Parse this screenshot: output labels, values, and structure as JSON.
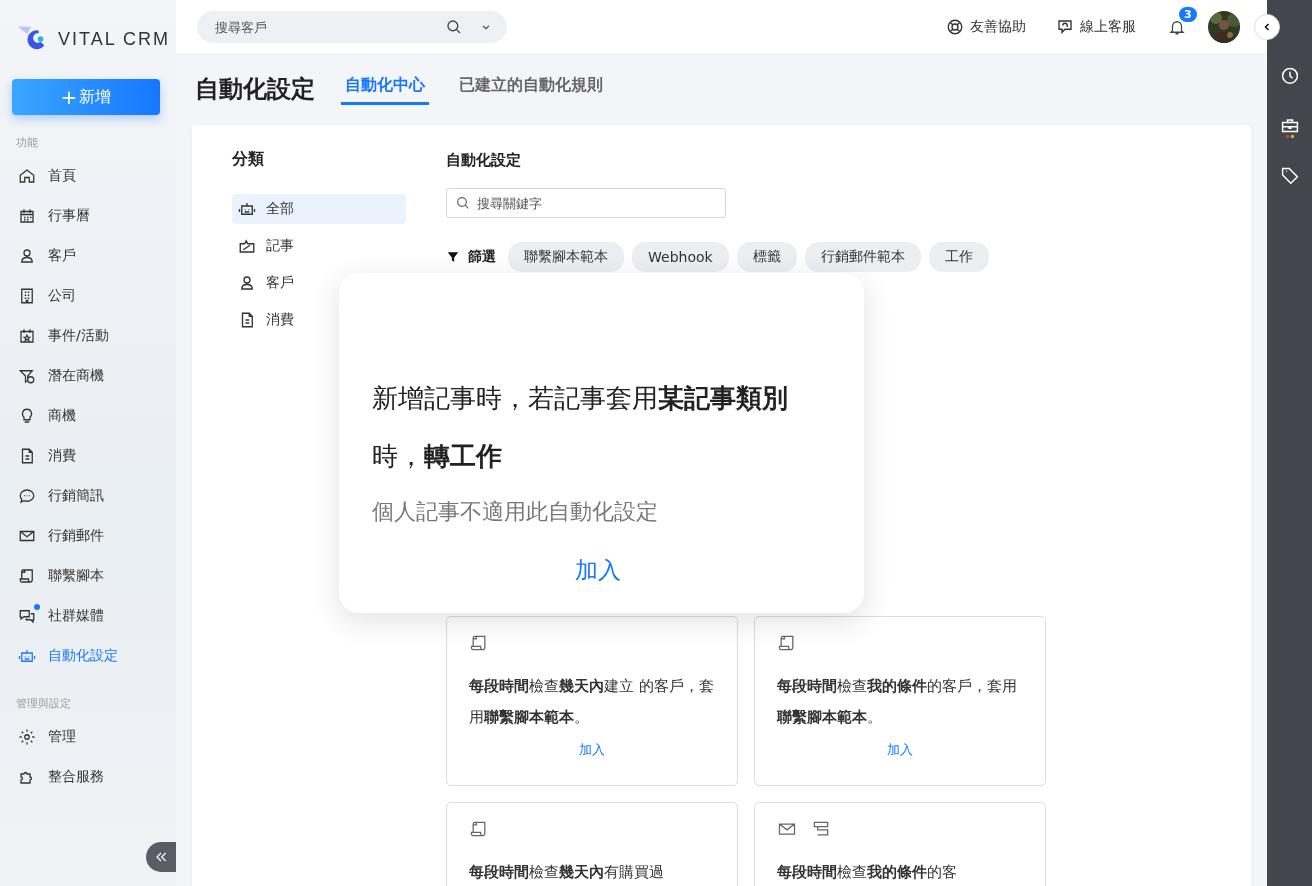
{
  "brand": {
    "name": "VITAL CRM"
  },
  "new_button": {
    "icon_char": "+",
    "label": "新增"
  },
  "sidebar": {
    "sections": [
      {
        "title": "功能",
        "items": [
          {
            "label": "首頁",
            "selected": false,
            "dot": false
          },
          {
            "label": "行事曆",
            "selected": false,
            "dot": false
          },
          {
            "label": "客戶",
            "selected": false,
            "dot": false
          },
          {
            "label": "公司",
            "selected": false,
            "dot": false
          },
          {
            "label": "事件/活動",
            "selected": false,
            "dot": false
          },
          {
            "label": "潛在商機",
            "selected": false,
            "dot": false
          },
          {
            "label": "商機",
            "selected": false,
            "dot": false
          },
          {
            "label": "消費",
            "selected": false,
            "dot": false
          },
          {
            "label": "行銷簡訊",
            "selected": false,
            "dot": false
          },
          {
            "label": "行銷郵件",
            "selected": false,
            "dot": false
          },
          {
            "label": "聯繫腳本",
            "selected": false,
            "dot": false
          },
          {
            "label": "社群媒體",
            "selected": false,
            "dot": true
          },
          {
            "label": "自動化設定",
            "selected": true,
            "dot": false
          }
        ]
      },
      {
        "title": "管理與設定",
        "items": [
          {
            "label": "管理",
            "selected": false,
            "dot": false
          },
          {
            "label": "整合服務",
            "selected": false,
            "dot": false
          }
        ]
      }
    ]
  },
  "topbar": {
    "search": {
      "placeholder": "搜尋客戶"
    },
    "links": [
      {
        "label": "友善協助"
      },
      {
        "label": "線上客服"
      }
    ],
    "notifications": {
      "count": "3"
    }
  },
  "page": {
    "title": "自動化設定",
    "tabs": [
      {
        "label": "自動化中心",
        "selected": true
      },
      {
        "label": "已建立的自動化規則",
        "selected": false
      }
    ]
  },
  "categories": {
    "title": "分類",
    "items": [
      {
        "label": "全部",
        "selected": true
      },
      {
        "label": "記事",
        "selected": false
      },
      {
        "label": "客戶",
        "selected": false
      },
      {
        "label": "消費",
        "selected": false
      }
    ]
  },
  "automation": {
    "title": "自動化設定",
    "search": {
      "placeholder": "搜尋關鍵字"
    },
    "filter": {
      "label": "篩選",
      "chips": [
        "聯繫腳本範本",
        "Webhook",
        "標籤",
        "行銷郵件範本",
        "工作"
      ]
    },
    "popup": {
      "sentence": "新增記事時，若記事套用**某記事類別**時，**轉工作**",
      "note": "個人記事不適用此自動化設定",
      "action": "加入"
    },
    "cards": [
      {
        "sentence": "**每段時間**檢查**幾天內**建立 的客戶，套用**聯繫腳本範本**。",
        "action": "加入"
      },
      {
        "sentence": "**每段時間**檢查**我的條件**的客戶，套用**聯繫腳本範本**。",
        "action": "加入"
      },
      {
        "sentence": "**每段時間**檢查**幾天內**有購買過"
      },
      {
        "sentence": "**每段時間**檢查**我的條件**的客"
      }
    ]
  }
}
